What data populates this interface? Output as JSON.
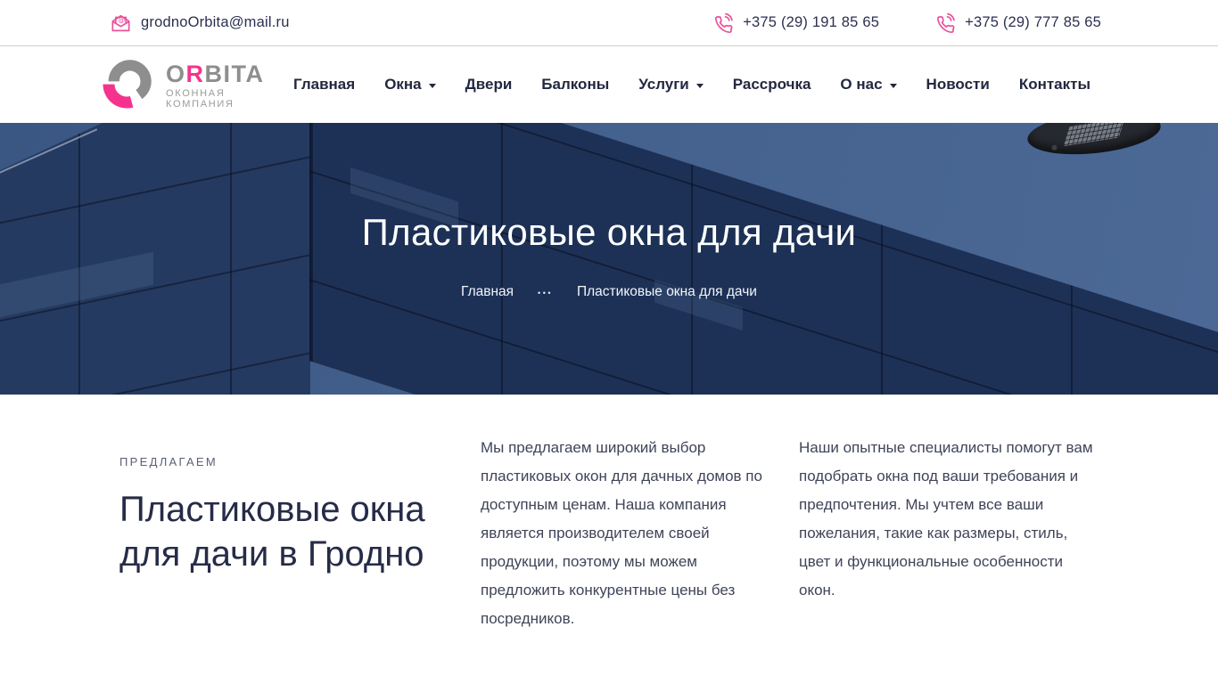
{
  "topbar": {
    "email": {
      "label": "grodnoOrbita@mail.ru"
    },
    "phones": [
      {
        "label": "+375 (29) 191 85 65"
      },
      {
        "label": "+375 (29) 777 85 65"
      }
    ]
  },
  "header": {
    "logo": {
      "brand_o": "O",
      "brand_r": "R",
      "brand_rest": "BITA",
      "tagline": "ОКОННАЯ КОМПАНИЯ"
    },
    "nav": {
      "items": [
        {
          "label": "Главная",
          "has_dropdown": false
        },
        {
          "label": "Окна",
          "has_dropdown": true
        },
        {
          "label": "Двери",
          "has_dropdown": false
        },
        {
          "label": "Балконы",
          "has_dropdown": false
        },
        {
          "label": "Услуги",
          "has_dropdown": true
        },
        {
          "label": "Рассрочка",
          "has_dropdown": false
        },
        {
          "label": "О нас",
          "has_dropdown": true
        },
        {
          "label": "Новости",
          "has_dropdown": false
        },
        {
          "label": "Контакты",
          "has_dropdown": false
        }
      ]
    }
  },
  "hero": {
    "title": "Пластиковые окна для дачи",
    "breadcrumb": {
      "home": "Главная",
      "separator": "•••",
      "current": "Пластиковые окна для дачи"
    }
  },
  "intro": {
    "kicker": "ПРЕДЛАГАЕМ",
    "heading": "Пластиковые окна для дачи в Гродно",
    "paragraphs": [
      "Мы предлагаем широкий выбор пластиковых окон для дачных домов по доступным ценам. Наша компания является производителем своей продукции, поэтому мы можем предложить конкурентные цены без посредников.",
      "Наши опытные специалисты помогут вам подобрать окна под ваши требования и предпочтения. Мы учтем все ваши пожелания, такие как размеры, стиль, цвет и функциональные особенности окон."
    ]
  },
  "colors": {
    "accent_pink": "#e9529b",
    "logo_pink": "#f5338f",
    "logo_gray": "#8e8e8e",
    "nav_text": "#23283f",
    "hero_sky": "#44618d",
    "building_dark": "#1d3156",
    "building_light": "#253a61"
  }
}
